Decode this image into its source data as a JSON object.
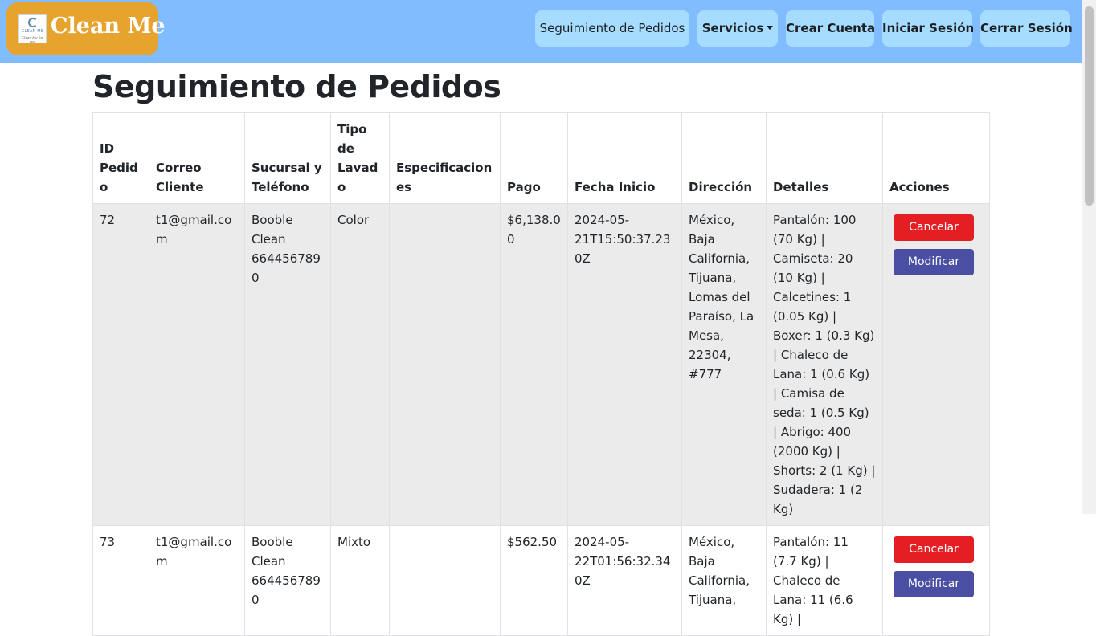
{
  "navbar": {
    "brand_name": "Clean Me",
    "logo_text": "CLEAN ME",
    "logo_tagline": "Clean Me for you",
    "items": [
      {
        "label": "Seguimiento de Pedidos"
      },
      {
        "label": "Servicios"
      },
      {
        "label": "Crear Cuenta"
      },
      {
        "label": "Iniciar Sesión"
      },
      {
        "label": "Cerrar Sesión"
      }
    ]
  },
  "page": {
    "title": "Seguimiento de Pedidos"
  },
  "table": {
    "headers": [
      "ID Pedido",
      "Correo Cliente",
      "Sucursal y Teléfono",
      "Tipo de Lavado",
      "Especificaciones",
      "Pago",
      "Fecha Inicio",
      "Dirección",
      "Detalles",
      "Acciones"
    ],
    "rows": [
      {
        "id": "72",
        "correo": "t1@gmail.com",
        "sucursal": "Booble Clean 6644567890",
        "tipo": "Color",
        "especificaciones": "",
        "pago": "$6,138.00",
        "fecha": "2024-05-21T15:50:37.230Z",
        "direccion": "México, Baja California, Tijuana, Lomas del Paraíso, La Mesa, 22304, #777",
        "detalles": "Pantalón: 100 (70 Kg) | Camiseta: 20 (10 Kg) | Calcetines: 1 (0.05 Kg) | Boxer: 1 (0.3 Kg) | Chaleco de Lana: 1 (0.6 Kg) | Camisa de seda: 1 (0.5 Kg) | Abrigo: 400 (2000 Kg) | Shorts: 2 (1 Kg) | Sudadera: 1 (2 Kg)",
        "cancel_label": "Cancelar",
        "modify_label": "Modificar"
      },
      {
        "id": "73",
        "correo": "t1@gmail.com",
        "sucursal": "Booble Clean 6644567890",
        "tipo": "Mixto",
        "especificaciones": "",
        "pago": "$562.50",
        "fecha": "2024-05-22T01:56:32.340Z",
        "direccion": "México, Baja California, Tijuana,",
        "detalles": "Pantalón: 11 (7.7 Kg) | Chaleco de Lana: 11 (6.6 Kg) |",
        "cancel_label": "Cancelar",
        "modify_label": "Modificar"
      }
    ]
  },
  "colors": {
    "navbar_bg": "#80bcff",
    "brand_bg": "#e6a32e",
    "nav_button_bg": "#a5dcff",
    "cancel_button": "#e51e24",
    "modify_button": "#4a4fa4",
    "row_gray": "#ebebeb"
  }
}
